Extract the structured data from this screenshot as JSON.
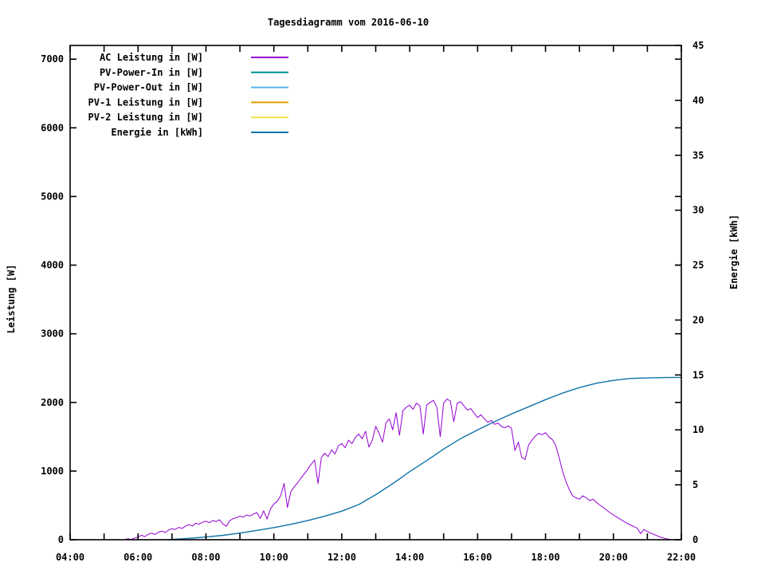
{
  "chart_data": {
    "type": "line",
    "title": "Tagesdiagramm vom 2016-06-10",
    "xlabel": "",
    "ylabel": "Leistung [W]",
    "y2label": "Energie [kWh]",
    "grid": false,
    "legend_position": "top-left-inside",
    "x_axis": {
      "unit": "time",
      "range_hours": [
        4,
        22
      ],
      "minor_tick_every_hours": 1,
      "labeled_ticks": [
        {
          "h": 4,
          "label": "04:00"
        },
        {
          "h": 6,
          "label": "06:00"
        },
        {
          "h": 8,
          "label": "08:00"
        },
        {
          "h": 10,
          "label": "10:00"
        },
        {
          "h": 12,
          "label": "12:00"
        },
        {
          "h": 14,
          "label": "14:00"
        },
        {
          "h": 16,
          "label": "16:00"
        },
        {
          "h": 18,
          "label": "18:00"
        },
        {
          "h": 20,
          "label": "20:00"
        },
        {
          "h": 22,
          "label": "22:00"
        }
      ]
    },
    "y_axis": {
      "ticks": [
        0,
        1000,
        2000,
        3000,
        4000,
        5000,
        6000,
        7000
      ],
      "range": [
        0,
        7200
      ]
    },
    "y2_axis": {
      "ticks": [
        0,
        5,
        10,
        15,
        20,
        25,
        30,
        35,
        40,
        45
      ],
      "range": [
        0,
        45
      ]
    },
    "series": [
      {
        "name": "AC Leistung in [W]",
        "color": "#9400D3",
        "axis": "y1",
        "width": 1,
        "points": [
          [
            5.6,
            0
          ],
          [
            5.7,
            15
          ],
          [
            5.8,
            5
          ],
          [
            5.9,
            25
          ],
          [
            6.0,
            40
          ],
          [
            6.1,
            65
          ],
          [
            6.2,
            45
          ],
          [
            6.3,
            80
          ],
          [
            6.4,
            95
          ],
          [
            6.5,
            75
          ],
          [
            6.6,
            110
          ],
          [
            6.7,
            125
          ],
          [
            6.8,
            105
          ],
          [
            6.9,
            140
          ],
          [
            7.0,
            160
          ],
          [
            7.1,
            150
          ],
          [
            7.2,
            180
          ],
          [
            7.3,
            165
          ],
          [
            7.4,
            200
          ],
          [
            7.5,
            220
          ],
          [
            7.6,
            200
          ],
          [
            7.7,
            240
          ],
          [
            7.8,
            225
          ],
          [
            7.9,
            255
          ],
          [
            8.0,
            270
          ],
          [
            8.1,
            250
          ],
          [
            8.2,
            280
          ],
          [
            8.3,
            265
          ],
          [
            8.4,
            290
          ],
          [
            8.5,
            230
          ],
          [
            8.6,
            195
          ],
          [
            8.7,
            280
          ],
          [
            8.8,
            305
          ],
          [
            8.9,
            320
          ],
          [
            9.0,
            345
          ],
          [
            9.1,
            330
          ],
          [
            9.2,
            360
          ],
          [
            9.3,
            345
          ],
          [
            9.4,
            375
          ],
          [
            9.5,
            395
          ],
          [
            9.6,
            310
          ],
          [
            9.7,
            420
          ],
          [
            9.8,
            300
          ],
          [
            9.9,
            450
          ],
          [
            10.0,
            520
          ],
          [
            10.1,
            560
          ],
          [
            10.2,
            640
          ],
          [
            10.3,
            820
          ],
          [
            10.4,
            470
          ],
          [
            10.5,
            700
          ],
          [
            10.6,
            770
          ],
          [
            10.7,
            830
          ],
          [
            10.8,
            900
          ],
          [
            10.9,
            960
          ],
          [
            11.0,
            1030
          ],
          [
            11.1,
            1100
          ],
          [
            11.2,
            1160
          ],
          [
            11.3,
            820
          ],
          [
            11.4,
            1200
          ],
          [
            11.5,
            1260
          ],
          [
            11.6,
            1210
          ],
          [
            11.7,
            1310
          ],
          [
            11.8,
            1250
          ],
          [
            11.9,
            1370
          ],
          [
            12.0,
            1400
          ],
          [
            12.1,
            1340
          ],
          [
            12.2,
            1450
          ],
          [
            12.3,
            1400
          ],
          [
            12.4,
            1490
          ],
          [
            12.5,
            1540
          ],
          [
            12.6,
            1470
          ],
          [
            12.7,
            1580
          ],
          [
            12.8,
            1350
          ],
          [
            12.9,
            1450
          ],
          [
            13.0,
            1650
          ],
          [
            13.1,
            1550
          ],
          [
            13.2,
            1420
          ],
          [
            13.3,
            1700
          ],
          [
            13.4,
            1760
          ],
          [
            13.5,
            1600
          ],
          [
            13.6,
            1850
          ],
          [
            13.7,
            1520
          ],
          [
            13.8,
            1880
          ],
          [
            13.9,
            1930
          ],
          [
            14.0,
            1960
          ],
          [
            14.1,
            1900
          ],
          [
            14.2,
            1990
          ],
          [
            14.3,
            1950
          ],
          [
            14.4,
            1540
          ],
          [
            14.5,
            1960
          ],
          [
            14.6,
            2000
          ],
          [
            14.7,
            2030
          ],
          [
            14.8,
            1930
          ],
          [
            14.9,
            1500
          ],
          [
            15.0,
            1990
          ],
          [
            15.1,
            2050
          ],
          [
            15.2,
            2020
          ],
          [
            15.3,
            1720
          ],
          [
            15.4,
            1990
          ],
          [
            15.5,
            2010
          ],
          [
            15.6,
            1950
          ],
          [
            15.7,
            1890
          ],
          [
            15.8,
            1910
          ],
          [
            15.9,
            1840
          ],
          [
            16.0,
            1780
          ],
          [
            16.1,
            1820
          ],
          [
            16.2,
            1760
          ],
          [
            16.3,
            1710
          ],
          [
            16.4,
            1740
          ],
          [
            16.5,
            1680
          ],
          [
            16.6,
            1700
          ],
          [
            16.7,
            1650
          ],
          [
            16.8,
            1630
          ],
          [
            16.9,
            1660
          ],
          [
            17.0,
            1620
          ],
          [
            17.1,
            1300
          ],
          [
            17.2,
            1420
          ],
          [
            17.3,
            1200
          ],
          [
            17.4,
            1170
          ],
          [
            17.5,
            1380
          ],
          [
            17.6,
            1450
          ],
          [
            17.7,
            1510
          ],
          [
            17.8,
            1550
          ],
          [
            17.9,
            1530
          ],
          [
            18.0,
            1560
          ],
          [
            18.1,
            1500
          ],
          [
            18.2,
            1460
          ],
          [
            18.3,
            1380
          ],
          [
            18.4,
            1200
          ],
          [
            18.5,
            1000
          ],
          [
            18.6,
            850
          ],
          [
            18.7,
            730
          ],
          [
            18.8,
            640
          ],
          [
            18.9,
            610
          ],
          [
            19.0,
            590
          ],
          [
            19.1,
            640
          ],
          [
            19.2,
            610
          ],
          [
            19.3,
            570
          ],
          [
            19.4,
            590
          ],
          [
            19.5,
            545
          ],
          [
            19.6,
            505
          ],
          [
            19.7,
            470
          ],
          [
            19.8,
            430
          ],
          [
            19.9,
            395
          ],
          [
            20.0,
            360
          ],
          [
            20.1,
            330
          ],
          [
            20.2,
            300
          ],
          [
            20.3,
            270
          ],
          [
            20.4,
            240
          ],
          [
            20.5,
            215
          ],
          [
            20.6,
            190
          ],
          [
            20.7,
            170
          ],
          [
            20.8,
            90
          ],
          [
            20.9,
            150
          ],
          [
            21.0,
            120
          ],
          [
            21.1,
            95
          ],
          [
            21.2,
            75
          ],
          [
            21.3,
            55
          ],
          [
            21.4,
            35
          ],
          [
            21.5,
            20
          ],
          [
            21.6,
            10
          ],
          [
            21.7,
            0
          ]
        ]
      },
      {
        "name": "PV-Power-In in [W]",
        "color": "#009193",
        "axis": "y1",
        "width": 1,
        "points": []
      },
      {
        "name": "PV-Power-Out in [W]",
        "color": "#56B4E9",
        "axis": "y1",
        "width": 1,
        "points": []
      },
      {
        "name": "PV-1 Leistung in [W]",
        "color": "#E0A000",
        "axis": "y1",
        "width": 1,
        "points": []
      },
      {
        "name": "PV-2 Leistung in [W]",
        "color": "#F0E442",
        "axis": "y1",
        "width": 1,
        "points": []
      },
      {
        "name": "Energie in [kWh]",
        "color": "#0E72A8",
        "axis": "y2",
        "width": 1.4,
        "points": [
          [
            6.9,
            0
          ],
          [
            7.0,
            0.03
          ],
          [
            7.5,
            0.12
          ],
          [
            8.0,
            0.25
          ],
          [
            8.5,
            0.4
          ],
          [
            9.0,
            0.6
          ],
          [
            9.5,
            0.85
          ],
          [
            10.0,
            1.1
          ],
          [
            10.5,
            1.4
          ],
          [
            11.0,
            1.75
          ],
          [
            11.5,
            2.15
          ],
          [
            12.0,
            2.6
          ],
          [
            12.5,
            3.2
          ],
          [
            13.0,
            4.1
          ],
          [
            13.5,
            5.1
          ],
          [
            14.0,
            6.2
          ],
          [
            14.5,
            7.2
          ],
          [
            15.0,
            8.25
          ],
          [
            15.5,
            9.2
          ],
          [
            16.0,
            10.0
          ],
          [
            16.5,
            10.75
          ],
          [
            17.0,
            11.45
          ],
          [
            17.5,
            12.1
          ],
          [
            18.0,
            12.75
          ],
          [
            18.5,
            13.35
          ],
          [
            19.0,
            13.85
          ],
          [
            19.5,
            14.25
          ],
          [
            20.0,
            14.5
          ],
          [
            20.5,
            14.68
          ],
          [
            21.0,
            14.73
          ],
          [
            21.5,
            14.76
          ],
          [
            22.0,
            14.78
          ]
        ]
      }
    ]
  }
}
